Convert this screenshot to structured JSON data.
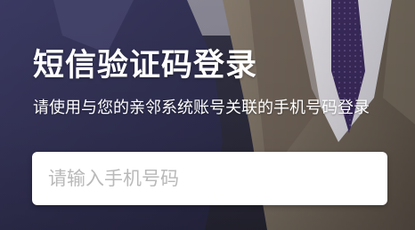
{
  "login": {
    "title": "短信验证码登录",
    "subtitle": "请使用与您的亲邻系统账号关联的手机号码登录",
    "phone_input": {
      "placeholder": "请输入手机号码",
      "value": ""
    }
  },
  "colors": {
    "text": "#ffffff",
    "input_bg": "#ffffff",
    "placeholder": "#b9b9b9"
  }
}
